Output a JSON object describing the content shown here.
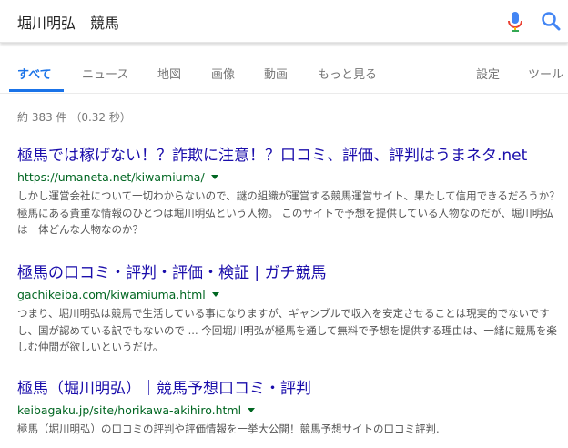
{
  "search": {
    "query": "堀川明弘　競馬"
  },
  "tabs": [
    {
      "label": "すべて",
      "active": true
    },
    {
      "label": "ニュース",
      "active": false
    },
    {
      "label": "地図",
      "active": false
    },
    {
      "label": "画像",
      "active": false
    },
    {
      "label": "動画",
      "active": false
    },
    {
      "label": "もっと見る",
      "active": false
    },
    {
      "label": "設定",
      "active": false
    },
    {
      "label": "ツール",
      "active": false
    }
  ],
  "stats": "約 383 件 （0.32 秒）",
  "results": [
    {
      "title": "極馬では稼げない！？詐欺に注意！？口コミ、評価、評判はうまネタ.net",
      "url": "https://umaneta.net/kiwamiuma/",
      "snippet": "しかし運営会社について一切わからないので、謎の組織が運営する競馬運営サイト、果たして信用できるだろうか？ 極馬にある貴重な情報のひとつは堀川明弘という人物。 このサイトで予想を提供している人物なのだが、堀川明弘は一体どんな人物なのか？"
    },
    {
      "title": "極馬の口コミ・評判・評価・検証 | ガチ競馬",
      "url": "gachikeiba.com/kiwamiuma.html",
      "snippet": "つまり、堀川明弘は競馬で生活している事になりますが、ギャンブルで収入を安定させることは現実的でないですし、国が認めている訳でもないので ... 今回堀川明弘が極馬を通して無料で予想を提供する理由は、一緒に競馬を楽しむ仲間が欲しいというだけ。"
    },
    {
      "title": "極馬（堀川明弘）｜競馬予想口コミ・評判",
      "url": "keibagaku.jp/site/horikawa-akihiro.html",
      "snippet": "極馬（堀川明弘）の口コミの評判や評価情報を一挙大公開！競馬予想サイトの口コミ評判."
    }
  ],
  "colors": {
    "link": "#1a0dab",
    "url": "#006621",
    "accent": "#1a73e8",
    "snippet": "#545454"
  }
}
